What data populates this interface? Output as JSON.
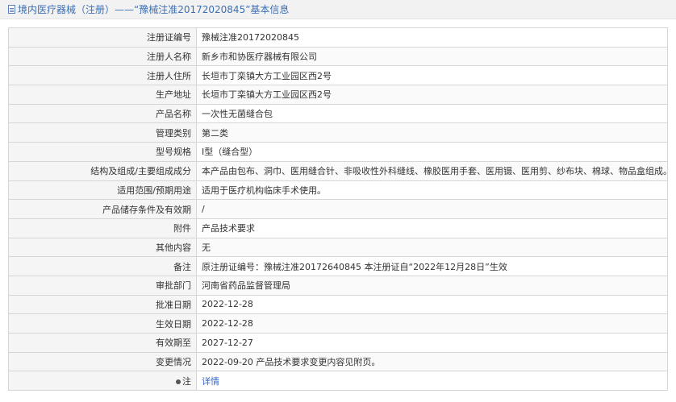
{
  "header": {
    "title": "境内医疗器械（注册）——“豫械注准20172020845”基本信息"
  },
  "rows": [
    {
      "label": "注册证编号",
      "value": "豫械注准20172020845"
    },
    {
      "label": "注册人名称",
      "value": "新乡市和协医疗器械有限公司"
    },
    {
      "label": "注册人住所",
      "value": "长垣市丁栾镇大方工业园区西2号"
    },
    {
      "label": "生产地址",
      "value": "长垣市丁栾镇大方工业园区西2号"
    },
    {
      "label": "产品名称",
      "value": "一次性无菌缝合包"
    },
    {
      "label": "管理类别",
      "value": "第二类"
    },
    {
      "label": "型号规格",
      "value": "Ⅰ型（缝合型）"
    },
    {
      "label": "结构及组成/主要组成成分",
      "value": "本产品由包布、洞巾、医用缝合针、非吸收性外科缝线、橡胶医用手套、医用镊、医用剪、纱布块、棉球、物品盒组成。"
    },
    {
      "label": "适用范围/预期用途",
      "value": "适用于医疗机构临床手术使用。"
    },
    {
      "label": "产品储存条件及有效期",
      "value": "/"
    },
    {
      "label": "附件",
      "value": "产品技术要求"
    },
    {
      "label": "其他内容",
      "value": "无"
    },
    {
      "label": "备注",
      "value": "原注册证编号：豫械注准20172640845 本注册证自“2022年12月28日”生效"
    },
    {
      "label": "审批部门",
      "value": "河南省药品监督管理局"
    },
    {
      "label": "批准日期",
      "value": "2022-12-28"
    },
    {
      "label": "生效日期",
      "value": "2022-12-28"
    },
    {
      "label": "有效期至",
      "value": "2027-12-27"
    },
    {
      "label": "变更情况",
      "value": "2022-09-20 产品技术要求变更内容见附页。"
    }
  ],
  "note_row": {
    "label": "注",
    "link": "详情"
  }
}
